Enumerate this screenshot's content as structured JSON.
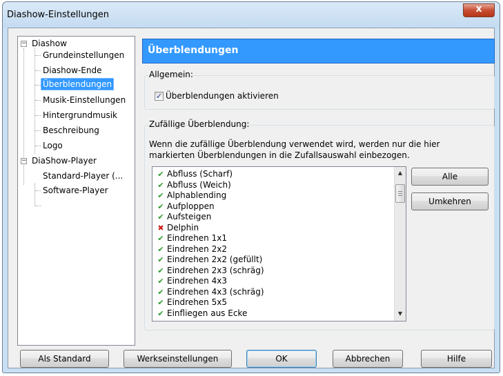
{
  "window": {
    "title": "Diashow-Einstellungen",
    "close_symbol": "x"
  },
  "tree": {
    "collapse_symbol": "−",
    "groups": [
      {
        "label": "Diashow",
        "children": [
          "Grundeinstellungen",
          "Diashow-Ende",
          "Überblendungen",
          "Musik-Einstellungen",
          "Hintergrundmusik",
          "Beschreibung",
          "Logo"
        ]
      },
      {
        "label": "DiaShow-Player",
        "children": [
          "Standard-Player (...",
          "Software-Player"
        ]
      }
    ],
    "selected": "Überblendungen"
  },
  "page": {
    "header": "Überblendungen",
    "general_group": "Allgemein:",
    "enable_checkbox": {
      "label": "Überblendungen aktivieren",
      "checked": true,
      "check_symbol": "✓"
    },
    "random_group": "Zufällige Überblendung:",
    "description": "Wenn die zufällige Überblendung verwendet wird, werden nur die hier markierten Überblendungen in die Zufallsauswahl einbezogen.",
    "transitions": [
      {
        "label": "Abfluss (Scharf)",
        "enabled": true
      },
      {
        "label": "Abfluss (Weich)",
        "enabled": true
      },
      {
        "label": "Alphablending",
        "enabled": true
      },
      {
        "label": "Aufploppen",
        "enabled": true
      },
      {
        "label": "Aufsteigen",
        "enabled": true
      },
      {
        "label": "Delphin",
        "enabled": false
      },
      {
        "label": "Eindrehen 1x1",
        "enabled": true
      },
      {
        "label": "Eindrehen 2x2",
        "enabled": true
      },
      {
        "label": "Eindrehen 2x2 (gefüllt)",
        "enabled": true
      },
      {
        "label": "Eindrehen 2x3 (schräg)",
        "enabled": true
      },
      {
        "label": "Eindrehen 4x3",
        "enabled": true
      },
      {
        "label": "Eindrehen 4x3 (schräg)",
        "enabled": true
      },
      {
        "label": "Eindrehen 5x5",
        "enabled": true
      },
      {
        "label": "Einfliegen aus Ecke",
        "enabled": true
      }
    ],
    "marks": {
      "enabled": "✔",
      "disabled": "✖"
    },
    "scroll": {
      "up": "▲",
      "down": "▼"
    },
    "all_button": "Alle",
    "invert_button": "Umkehren"
  },
  "footer": {
    "as_default": "Als Standard",
    "factory_settings": "Werkseinstellungen",
    "ok": "OK",
    "cancel": "Abbrechen",
    "help": "Hilfe"
  },
  "colors": {
    "selection": "#3399ff",
    "enabled_mark": "#2a9a2a",
    "disabled_mark": "#d11c1c"
  }
}
